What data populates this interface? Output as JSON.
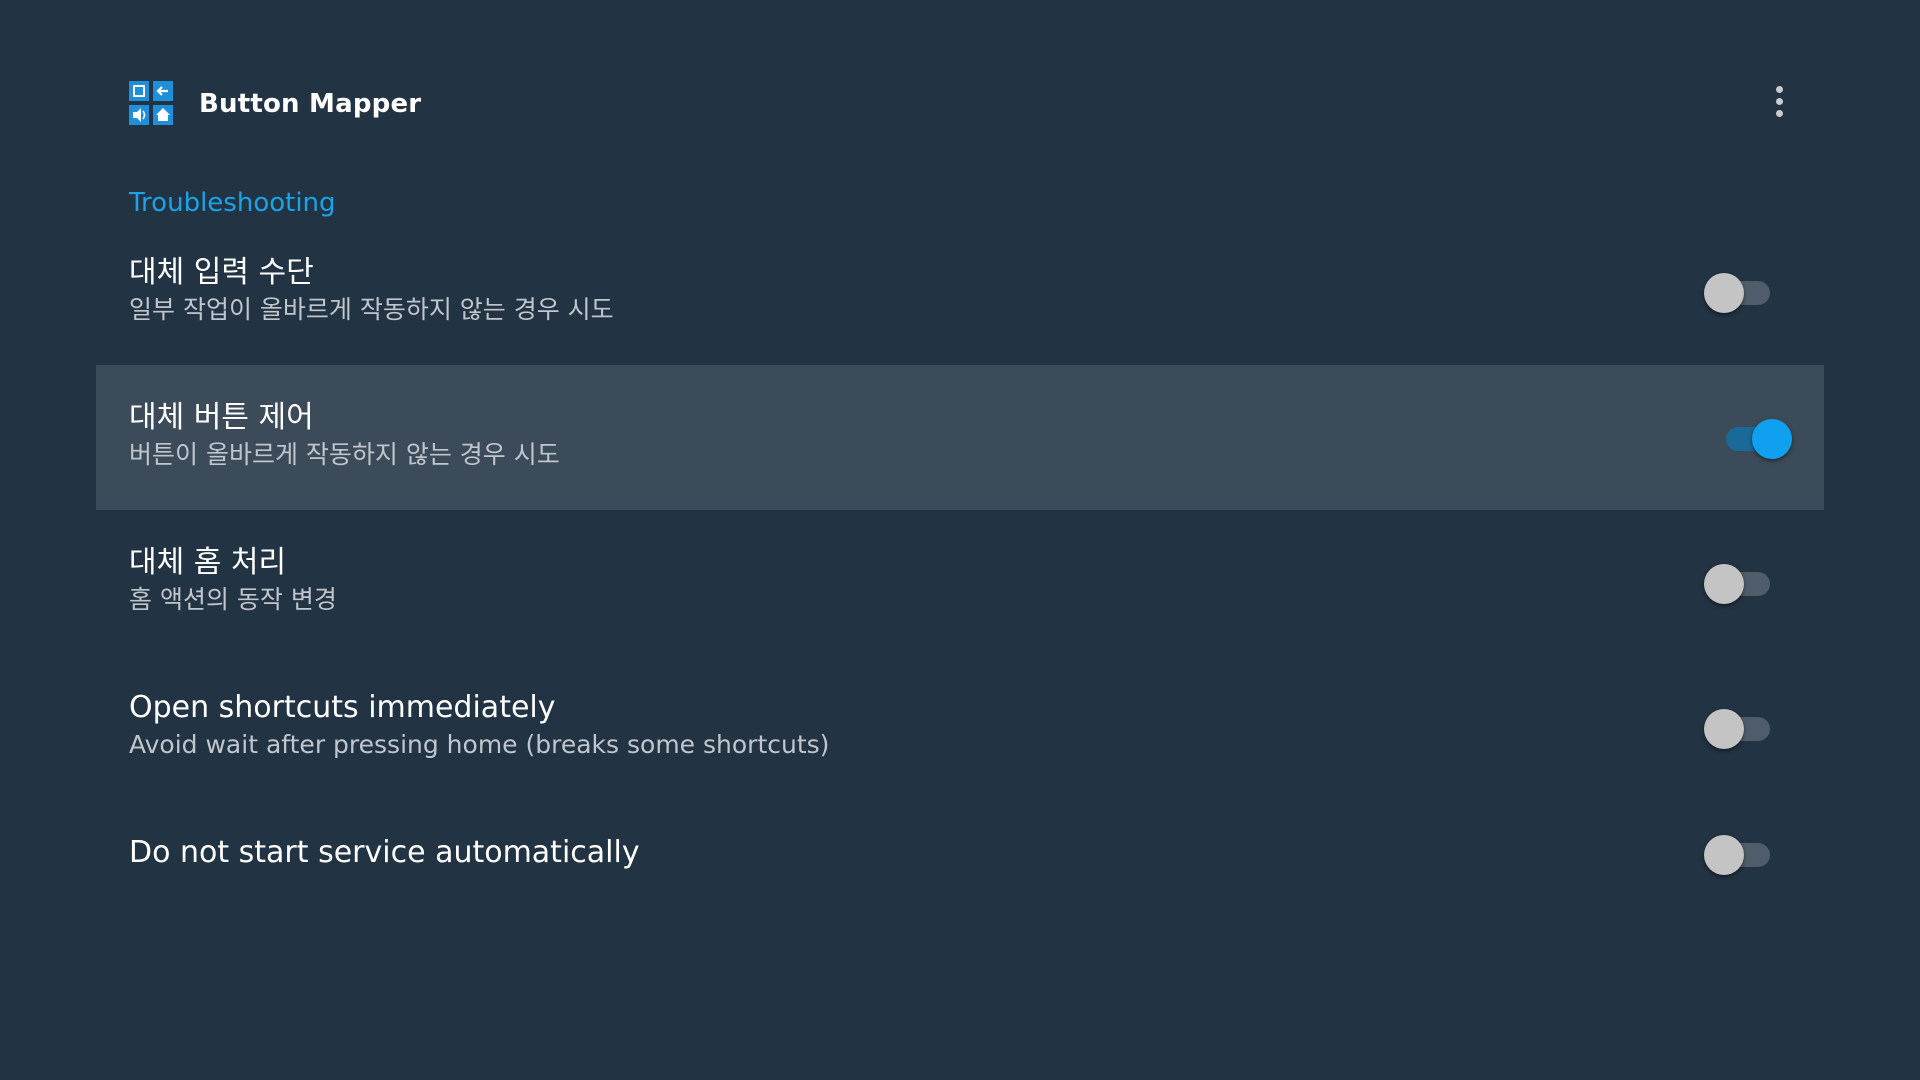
{
  "app_bar": {
    "title": "Button Mapper",
    "icon": "button-mapper-app-icon",
    "overflow_icon": "more-vert-icon"
  },
  "section": {
    "title": "Troubleshooting"
  },
  "settings": [
    {
      "title": "대체 입력 수단",
      "summary": "일부 작업이 올바르게 작동하지 않는 경우 시도",
      "enabled": false,
      "focused": false
    },
    {
      "title": "대체 버튼 제어",
      "summary": "버튼이 올바르게 작동하지 않는 경우 시도",
      "enabled": true,
      "focused": true
    },
    {
      "title": "대체 홈 처리",
      "summary": "홈 액션의 동작 변경",
      "enabled": false,
      "focused": false
    },
    {
      "title": "Open shortcuts immediately",
      "summary": "Avoid wait after pressing home (breaks some shortcuts)",
      "enabled": false,
      "focused": false
    },
    {
      "title": "Do not start service automatically",
      "summary": "",
      "enabled": false,
      "focused": false
    }
  ],
  "colors": {
    "background": "#223343",
    "accent": "#1aa3e8",
    "focused_row": "#3c4b59",
    "switch_on": "#0fa1f0",
    "switch_off_thumb": "#c4c4c4"
  }
}
